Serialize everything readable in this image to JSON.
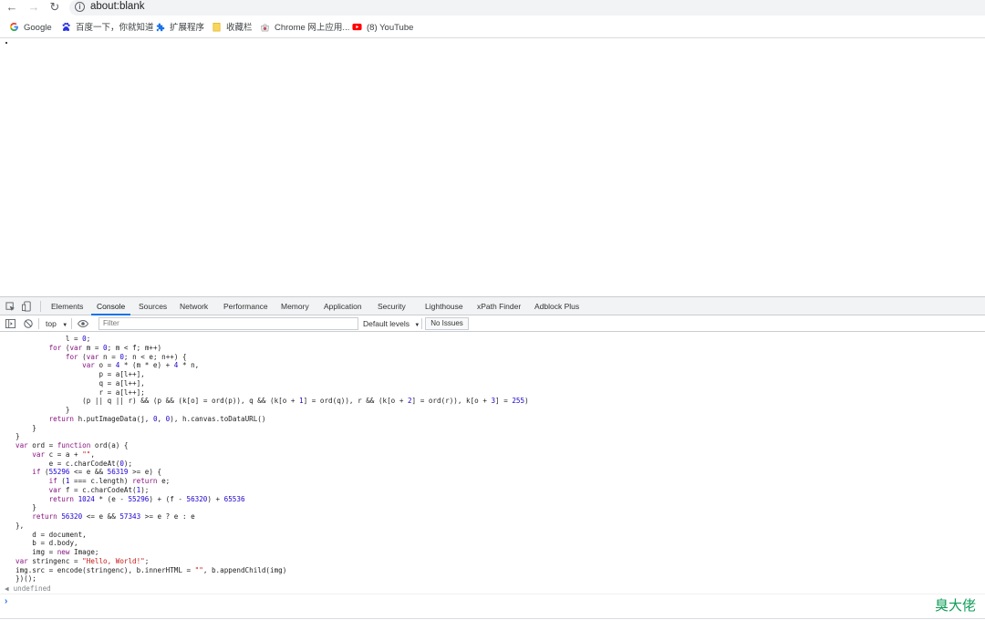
{
  "browser": {
    "url": "about:blank",
    "nav": {
      "back": "←",
      "forward": "→",
      "reload": "↻"
    },
    "bookmarks": [
      {
        "label": "Google",
        "icon": "google-icon"
      },
      {
        "label": "百度一下，你就知道",
        "icon": "baidu-icon"
      },
      {
        "label": "扩展程序",
        "icon": "puzzle-icon"
      },
      {
        "label": "收藏栏",
        "icon": "folder-icon"
      },
      {
        "label": "Chrome 网上应用...",
        "icon": "chrome-store-icon"
      },
      {
        "label": "(8) YouTube",
        "icon": "youtube-icon"
      }
    ]
  },
  "devtools": {
    "tabs": [
      "Elements",
      "Console",
      "Sources",
      "Network",
      "Performance",
      "Memory",
      "Application",
      "Security",
      "Lighthouse",
      "xPath Finder",
      "Adblock Plus"
    ],
    "active_tab": "Console",
    "console_bar": {
      "context": "top",
      "filter_placeholder": "Filter",
      "levels": "Default levels",
      "issues": "No Issues"
    },
    "code_lines": [
      "            l = 0;",
      "        for (var m = 0; m < f; m++)",
      "            for (var n = 0; n < e; n++) {",
      "                var o = 4 * (m * e) + 4 * n,",
      "                    p = a[l++],",
      "                    q = a[l++],",
      "                    r = a[l++];",
      "                (p || q || r) && (p && (k[o] = ord(p)), q && (k[o + 1] = ord(q)), r && (k[o + 2] = ord(r)), k[o + 3] = 255)",
      "            }",
      "        return h.putImageData(j, 0, 0), h.canvas.toDataURL()",
      "    }",
      "}",
      "var ord = function ord(a) {",
      "    var c = a + \"\",",
      "        e = c.charCodeAt(0);",
      "    if (55296 <= e && 56319 >= e) {",
      "        if (1 === c.length) return e;",
      "        var f = c.charCodeAt(1);",
      "        return 1024 * (e - 55296) + (f - 56320) + 65536",
      "    }",
      "    return 56320 <= e && 57343 >= e ? e : e",
      "},",
      "    d = document,",
      "    b = d.body,",
      "    img = new Image;",
      "var stringenc = \"Hello, World!\";",
      "img.src = encode(stringenc), b.innerHTML = \"\", b.appendChild(img)",
      "})();"
    ],
    "result": "undefined",
    "watermark": "臭大佬"
  }
}
